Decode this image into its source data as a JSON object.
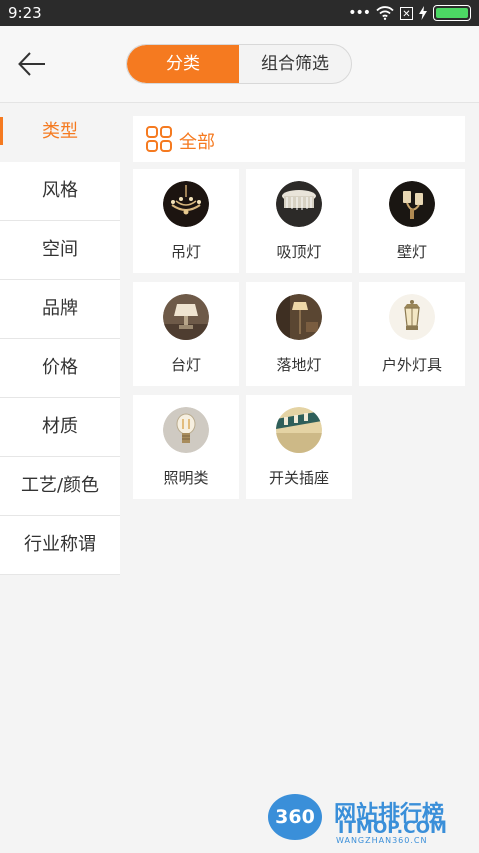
{
  "status_bar": {
    "time": "9:23",
    "dots": "•••",
    "battery_level": 1.0
  },
  "header": {
    "tabs": [
      {
        "label": "分类",
        "active": true
      },
      {
        "label": "组合筛选",
        "active": false
      }
    ]
  },
  "sidebar": {
    "items": [
      {
        "label": "类型",
        "active": true
      },
      {
        "label": "风格"
      },
      {
        "label": "空间"
      },
      {
        "label": "品牌"
      },
      {
        "label": "价格"
      },
      {
        "label": "材质"
      },
      {
        "label": "工艺/颜色"
      },
      {
        "label": "行业称谓"
      }
    ]
  },
  "content": {
    "all_label": "全部",
    "categories": [
      {
        "name": "吊灯",
        "icon": "chandelier-icon"
      },
      {
        "name": "吸顶灯",
        "icon": "ceiling-light-icon"
      },
      {
        "name": "壁灯",
        "icon": "wall-lamp-icon"
      },
      {
        "name": "台灯",
        "icon": "table-lamp-icon"
      },
      {
        "name": "落地灯",
        "icon": "floor-lamp-icon"
      },
      {
        "name": "户外灯具",
        "icon": "outdoor-lamp-icon"
      },
      {
        "name": "照明类",
        "icon": "bulb-icon"
      },
      {
        "name": "开关插座",
        "icon": "switch-socket-icon"
      }
    ]
  },
  "watermark": {
    "badge": "360",
    "line1": "网站排行榜",
    "line2": "ITMOP.COM",
    "line3": "WANGZHAN360.CN"
  },
  "colors": {
    "accent": "#f57a20",
    "status_bar": "#2b2b2b",
    "watermark": "#3a8fd9"
  }
}
